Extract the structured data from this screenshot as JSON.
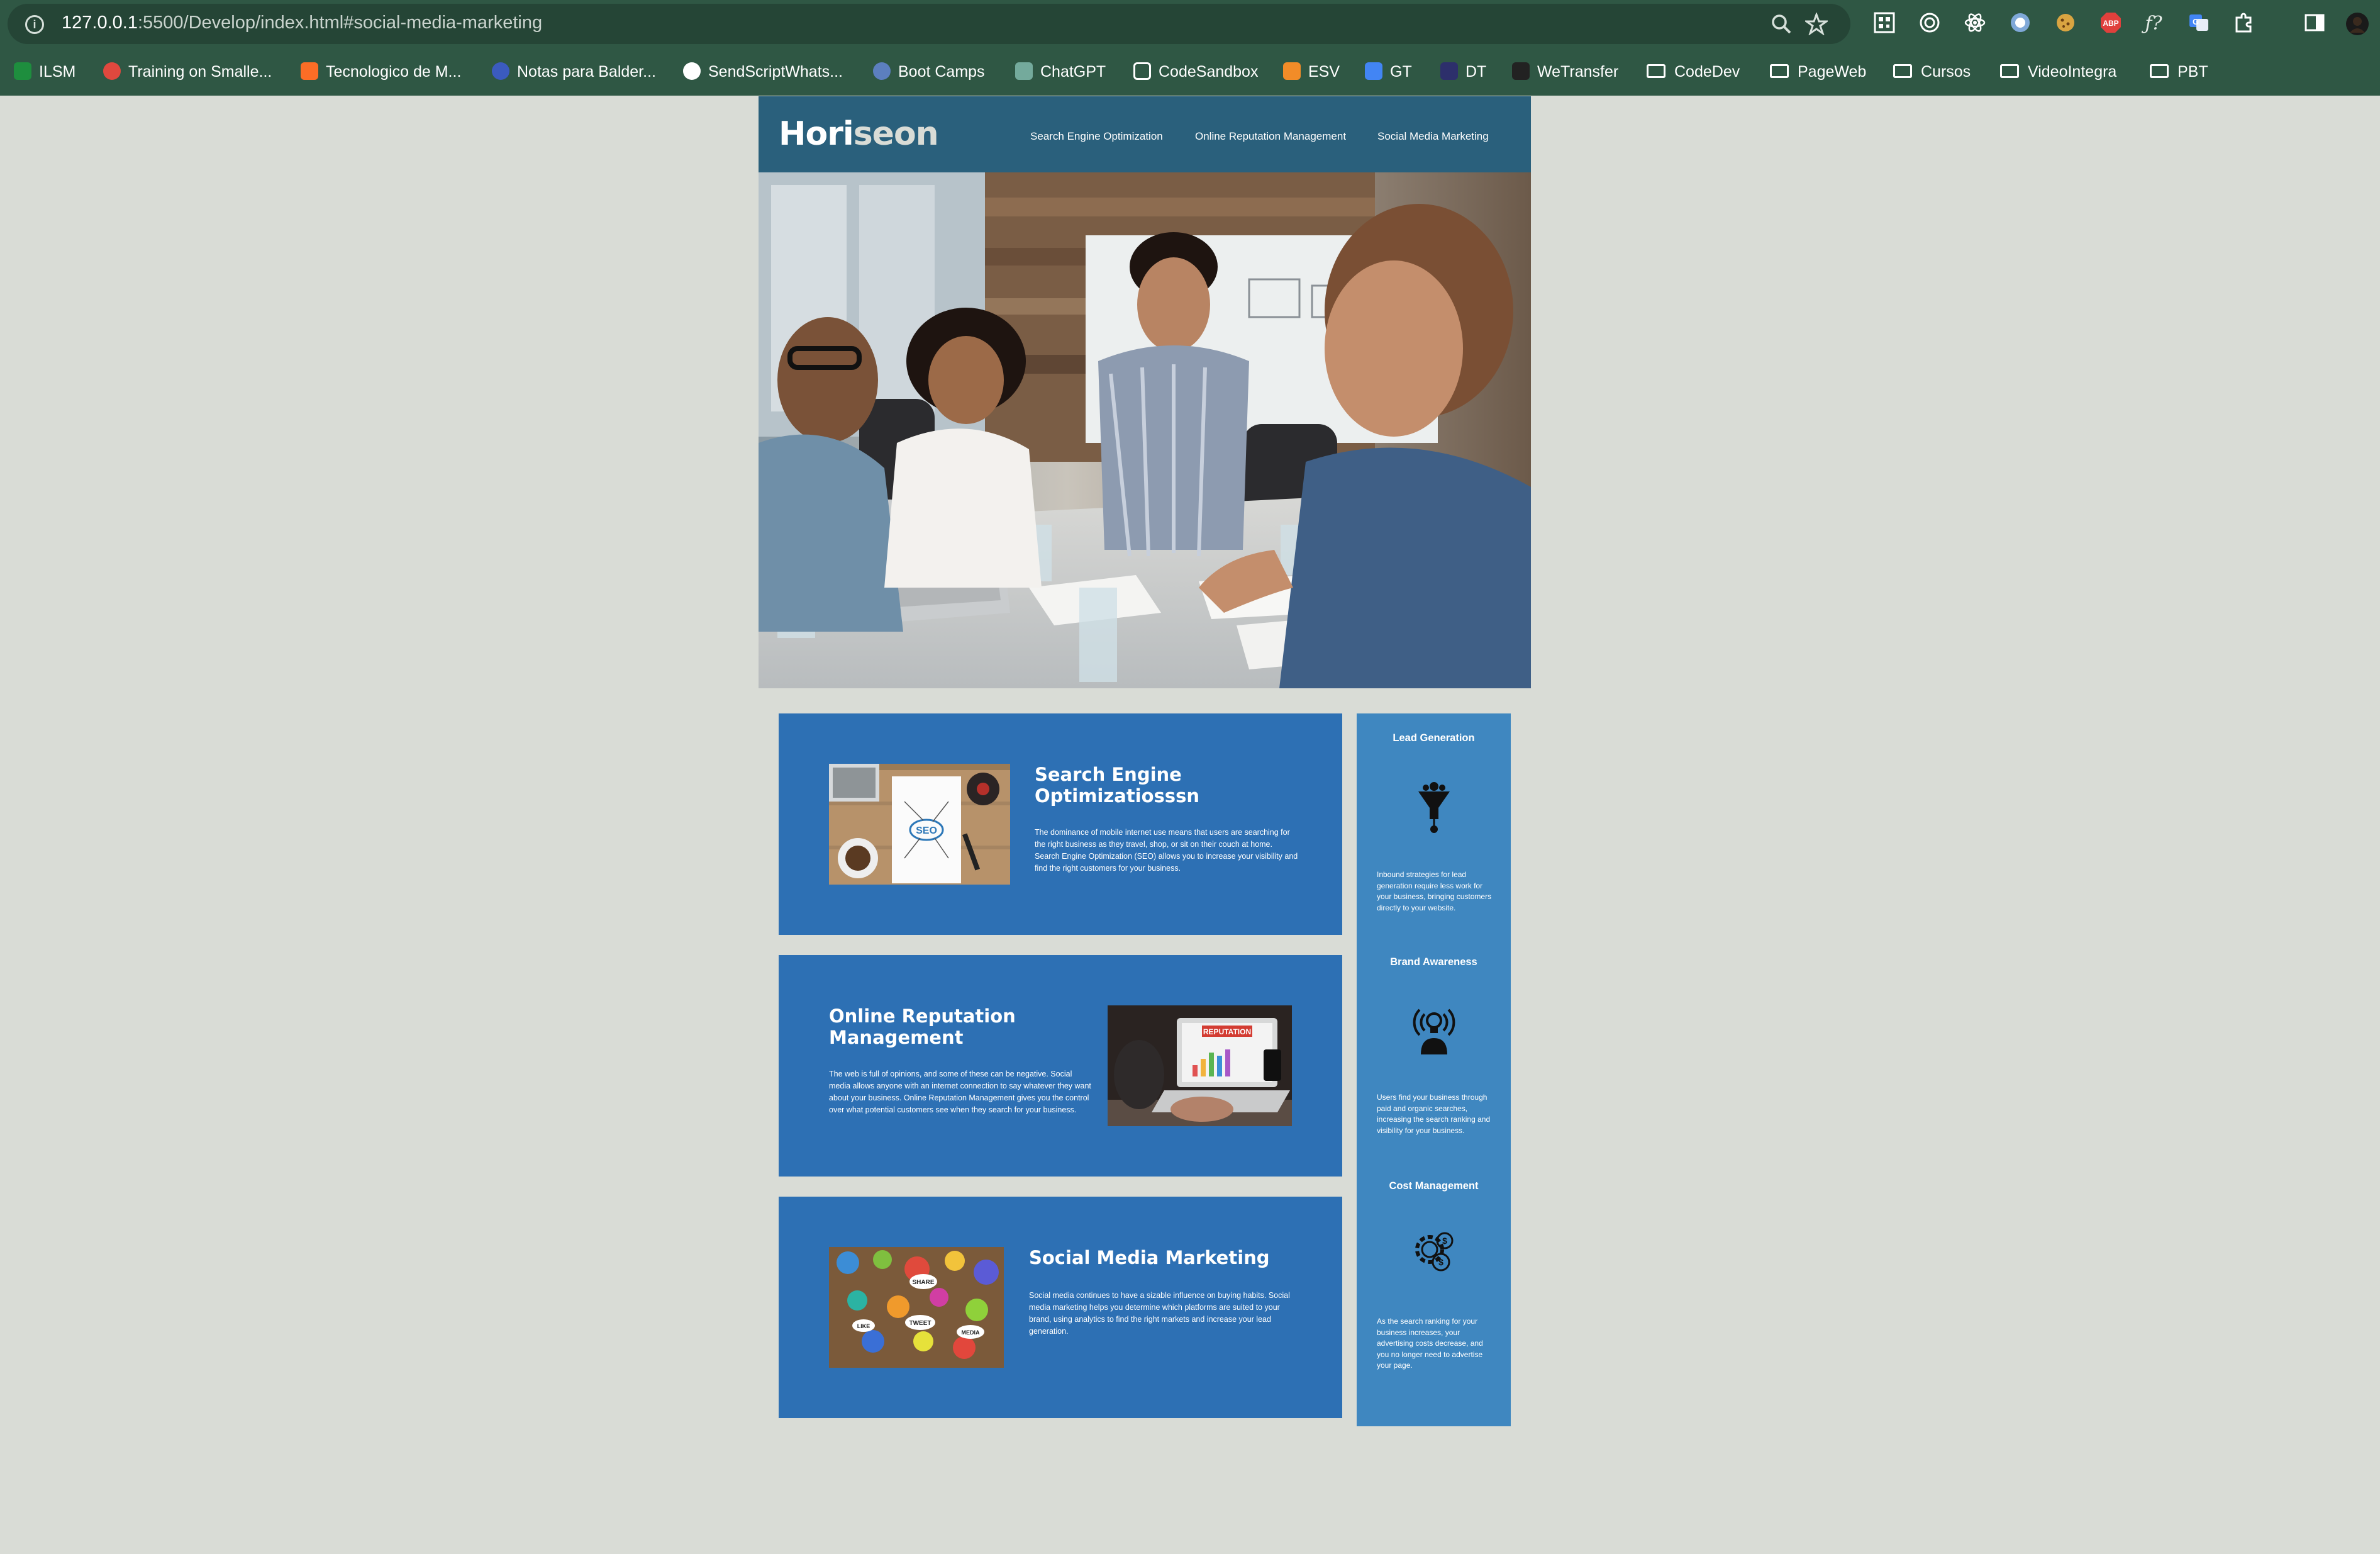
{
  "browser": {
    "url_host": "127.0.0.1",
    "url_rest": ":5500/Develop/index.html#social-media-marketing",
    "bookmarks": [
      {
        "label": "ILSM",
        "icon": "spreadsheet-icon",
        "color": "#1e8e3e"
      },
      {
        "label": "Training on Smalle...",
        "icon": "circle-logo-icon",
        "color": "#e0483e"
      },
      {
        "label": "Tecnologico de M...",
        "icon": "gitlab-icon",
        "color": "#fc6d26"
      },
      {
        "label": "Notas para Balder...",
        "icon": "globe-icon",
        "color": "#3b5bbf"
      },
      {
        "label": "SendScriptWhats...",
        "icon": "github-icon",
        "color": "#ffffff"
      },
      {
        "label": "Boot Camps",
        "icon": "globe-icon",
        "color": "#5c7fbf"
      },
      {
        "label": "ChatGPT",
        "icon": "openai-icon",
        "color": "#74aa9c"
      },
      {
        "label": "CodeSandbox",
        "icon": "codesandbox-icon",
        "color": "#ffffff"
      },
      {
        "label": "ESV",
        "icon": "esv-icon",
        "color": "#f28c28"
      },
      {
        "label": "GT",
        "icon": "translate-icon",
        "color": "#4285f4"
      },
      {
        "label": "DT",
        "icon": "play-icon",
        "color": "#2d2f6b"
      },
      {
        "label": "WeTransfer",
        "icon": "wetransfer-icon",
        "color": "#222222"
      },
      {
        "label": "CodeDev",
        "icon": "folder-icon",
        "color": ""
      },
      {
        "label": "PageWeb",
        "icon": "folder-icon",
        "color": ""
      },
      {
        "label": "Cursos",
        "icon": "folder-icon",
        "color": ""
      },
      {
        "label": "VideoIntegra",
        "icon": "folder-icon",
        "color": ""
      },
      {
        "label": "PBT",
        "icon": "folder-icon",
        "color": ""
      }
    ]
  },
  "header": {
    "logo_main": "Hori",
    "logo_accent": "seon",
    "nav": [
      "Search Engine Optimization",
      "Online Reputation Management",
      "Social Media Marketing"
    ]
  },
  "content": {
    "seo": {
      "title": "Search Engine Optimizatiosssn",
      "text": "The dominance of mobile internet use means that users are searching for the right business as they travel, shop, or sit on their couch at home. Search Engine Optimization (SEO) allows you to increase your visibility and find the right customers for your business.",
      "image_label": "SEO"
    },
    "orm": {
      "title": "Online Reputation Management",
      "text": "The web is full of opinions, and some of these can be negative. Social media allows anyone with an internet connection to say whatever they want about your business. Online Reputation Management gives you the control over what potential customers see when they search for your business.",
      "image_label": "REPUTATION"
    },
    "smm": {
      "title": "Social Media Marketing",
      "text": "Social media continues to have a sizable influence on buying habits. Social media marketing helps you determine which platforms are suited to your brand, using analytics to find the right markets and increase your lead generation.",
      "image_labels": [
        "SHARE",
        "TWEET",
        "LIKE",
        "MEDIA"
      ]
    }
  },
  "benefits": {
    "lead": {
      "title": "Lead Generation",
      "text": "Inbound strategies for lead generation require less work for your business, bringing customers directly to your website."
    },
    "brand": {
      "title": "Brand Awareness",
      "text": "Users find your business through paid and organic searches, increasing the search ranking and visibility for your business."
    },
    "cost": {
      "title": "Cost Management",
      "text": "As the search ranking for your business increases, your advertising costs decrease, and you no longer need to advertise your page."
    }
  }
}
